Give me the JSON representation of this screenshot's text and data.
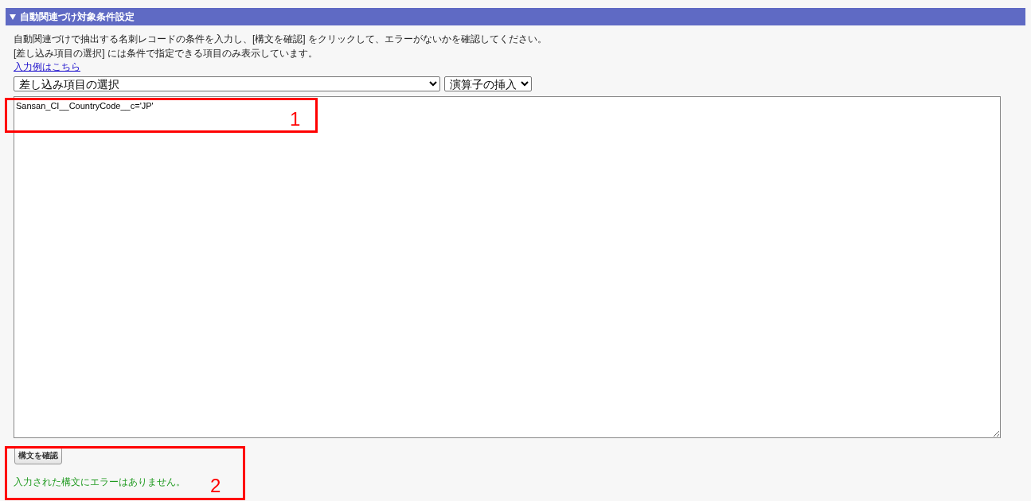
{
  "section": {
    "title": "自動関連づけ対象条件設定",
    "expanded": true
  },
  "instructions": [
    "自動関連づけで抽出する名刺レコードの条件を入力し、[構文を確認] をクリックして、エラーがないかを確認してください。",
    "[差し込み項目の選択] には条件で指定できる項目のみ表示しています。"
  ],
  "example_link": "入力例はこちら",
  "field_select": {
    "value": "差し込み項目の選択"
  },
  "operator_select": {
    "value": "演算子の挿入"
  },
  "condition": {
    "value": "Sansan_CI__CountryCode__c='JP'"
  },
  "check_button": "構文を確認",
  "result_message": "入力された構文にエラーはありません。",
  "annotations": [
    {
      "number": "1"
    },
    {
      "number": "2"
    }
  ]
}
